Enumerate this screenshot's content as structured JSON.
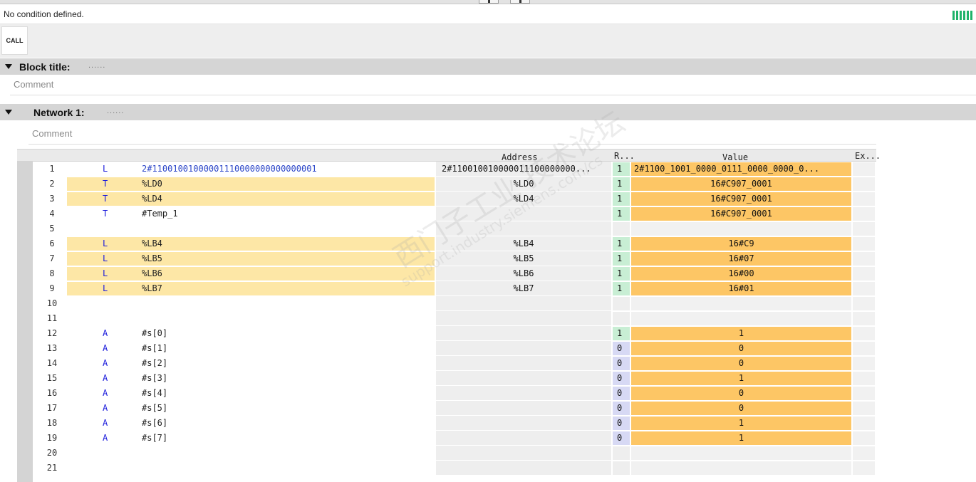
{
  "condition": {
    "text": "No condition defined.",
    "icon": "condition-status-icon",
    "icon_color": "#1eb36a"
  },
  "toolbar": {
    "call_label": "CALL"
  },
  "block": {
    "title_label": "Block title:",
    "title_placeholder": "......",
    "comment": "Comment"
  },
  "network": {
    "title_label": "Network 1:",
    "title_placeholder": "......",
    "comment": "Comment"
  },
  "watermark": {
    "line1": "西门子工业 技术论坛",
    "line2": "support.industry.siemens.com/cs"
  },
  "table": {
    "headers": {
      "address": "Address",
      "rlo": "R...",
      "value": "Value",
      "extra": "Ex..."
    },
    "rows": [
      {
        "line": "1",
        "instr": "L",
        "operand": "2#11001001000001110000000000000001",
        "address": "2#110010010000011100000000...",
        "rlo": "1",
        "value": "2#1100_1001_0000_0111_0000_0000_0...",
        "highlight": false,
        "value_hl": true
      },
      {
        "line": "2",
        "instr": "T",
        "operand": "%LD0",
        "address": "%LD0",
        "rlo": "1",
        "value": "16#C907_0001",
        "highlight": true,
        "value_hl": true
      },
      {
        "line": "3",
        "instr": "T",
        "operand": "%LD4",
        "address": "%LD4",
        "rlo": "1",
        "value": "16#C907_0001",
        "highlight": true,
        "value_hl": true
      },
      {
        "line": "4",
        "instr": "T",
        "operand": "#Temp_1",
        "address": "",
        "rlo": "1",
        "value": "16#C907_0001",
        "highlight": false,
        "value_hl": true
      },
      {
        "line": "5",
        "instr": "",
        "operand": "",
        "address": "",
        "rlo": "",
        "value": "",
        "highlight": false,
        "value_hl": false
      },
      {
        "line": "6",
        "instr": "L",
        "operand": "%LB4",
        "address": "%LB4",
        "rlo": "1",
        "value": "16#C9",
        "highlight": true,
        "value_hl": true
      },
      {
        "line": "7",
        "instr": "L",
        "operand": "%LB5",
        "address": "%LB5",
        "rlo": "1",
        "value": "16#07",
        "highlight": true,
        "value_hl": true
      },
      {
        "line": "8",
        "instr": "L",
        "operand": "%LB6",
        "address": "%LB6",
        "rlo": "1",
        "value": "16#00",
        "highlight": true,
        "value_hl": true
      },
      {
        "line": "9",
        "instr": "L",
        "operand": "%LB7",
        "address": "%LB7",
        "rlo": "1",
        "value": "16#01",
        "highlight": true,
        "value_hl": true
      },
      {
        "line": "10",
        "instr": "",
        "operand": "",
        "address": "",
        "rlo": "",
        "value": "",
        "highlight": false,
        "value_hl": false
      },
      {
        "line": "11",
        "instr": "",
        "operand": "",
        "address": "",
        "rlo": "",
        "value": "",
        "highlight": false,
        "value_hl": false
      },
      {
        "line": "12",
        "instr": "A",
        "operand": "#s[0]",
        "address": "",
        "rlo": "1",
        "value": "1",
        "highlight": false,
        "value_hl": true
      },
      {
        "line": "13",
        "instr": "A",
        "operand": "#s[1]",
        "address": "",
        "rlo": "0",
        "value": "0",
        "highlight": false,
        "value_hl": true
      },
      {
        "line": "14",
        "instr": "A",
        "operand": "#s[2]",
        "address": "",
        "rlo": "0",
        "value": "0",
        "highlight": false,
        "value_hl": true
      },
      {
        "line": "15",
        "instr": "A",
        "operand": "#s[3]",
        "address": "",
        "rlo": "0",
        "value": "1",
        "highlight": false,
        "value_hl": true
      },
      {
        "line": "16",
        "instr": "A",
        "operand": "#s[4]",
        "address": "",
        "rlo": "0",
        "value": "0",
        "highlight": false,
        "value_hl": true
      },
      {
        "line": "17",
        "instr": "A",
        "operand": "#s[5]",
        "address": "",
        "rlo": "0",
        "value": "0",
        "highlight": false,
        "value_hl": true
      },
      {
        "line": "18",
        "instr": "A",
        "operand": "#s[6]",
        "address": "",
        "rlo": "0",
        "value": "1",
        "highlight": false,
        "value_hl": true
      },
      {
        "line": "19",
        "instr": "A",
        "operand": "#s[7]",
        "address": "",
        "rlo": "0",
        "value": "1",
        "highlight": false,
        "value_hl": true
      },
      {
        "line": "20",
        "instr": "",
        "operand": "",
        "address": "",
        "rlo": "",
        "value": "",
        "highlight": false,
        "value_hl": false
      },
      {
        "line": "21",
        "instr": "",
        "operand": "",
        "address": "",
        "rlo": "",
        "value": "",
        "highlight": false,
        "value_hl": false
      }
    ]
  },
  "colors": {
    "code_highlight": "#fde7a6",
    "value_highlight": "#fdc665",
    "rlo_true": "#c8eed4",
    "rlo_false": "#d7d9f4",
    "instruction": "#1a1adb"
  }
}
